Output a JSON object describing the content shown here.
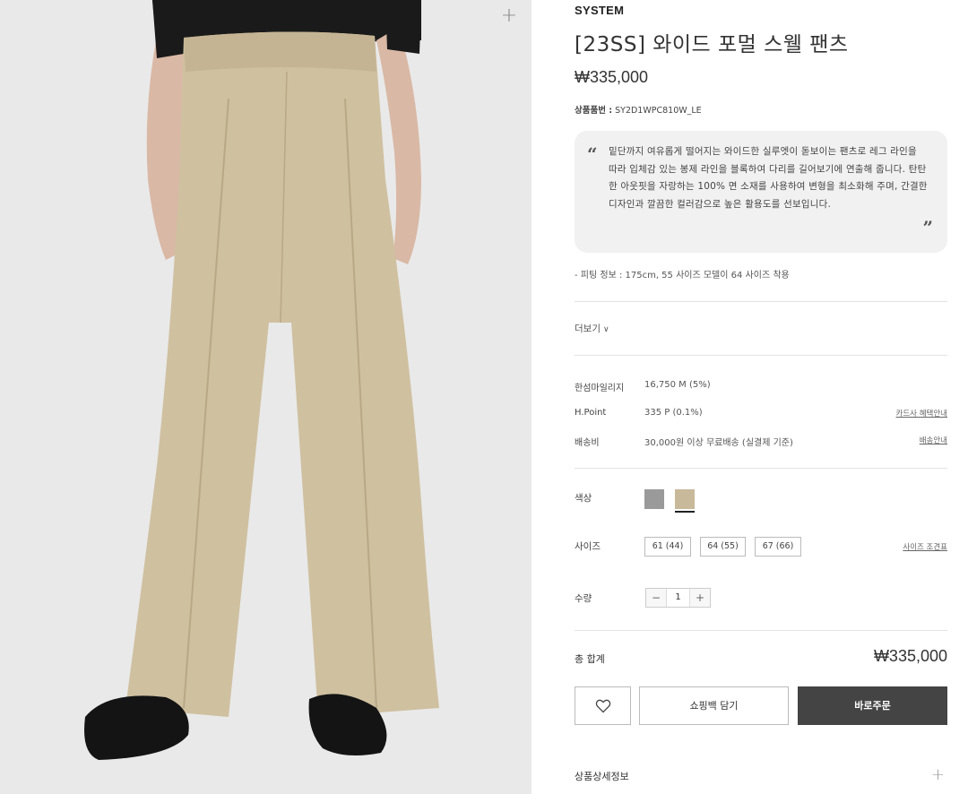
{
  "product": {
    "brand": "SYSTEM",
    "title": "[23SS] 와이드 포멀 스웰 팬츠",
    "price": "₩335,000",
    "code_label": "상품품번 :",
    "code_value": "SY2D1WPC810W_LE",
    "description": "밑단까지 여유롭게 떨어지는 와이드한 실루엣이 돋보이는 팬츠로 레그 라인을 따라 입체감 있는 봉제 라인을 블록하여 다리를 길어보기에 연출해 줍니다. 탄탄한 아웃핏을 자랑하는 100% 면 소재를 사용하여 변형을 최소화해 주며, 간결한 디자인과 깔끔한 컬러감으로 높은 활용도를 선보입니다.",
    "quote_open": "“",
    "quote_close": "”",
    "fit_info": "- 피팅 정보 : 175cm, 55 사이즈 모델이 64 사이즈 착용",
    "more_label": "더보기",
    "more_chevron": "∨"
  },
  "benefits": [
    {
      "key": "한섬마일리지",
      "value": "16,750 M (5%)",
      "link": ""
    },
    {
      "key": "H.Point",
      "value": "335 P (0.1%)",
      "link": "카드사 혜택안내"
    },
    {
      "key": "배송비",
      "value": "30,000원 이상 무료배송 (실결제 기준)",
      "link": "배송안내"
    }
  ],
  "options": {
    "color_label": "색상",
    "colors": [
      {
        "name": "gray",
        "hex": "#9a9a9a"
      },
      {
        "name": "beige",
        "hex": "#c8b99a",
        "selected": true
      }
    ],
    "size_label": "사이즈",
    "sizes": [
      "61 (44)",
      "64 (55)",
      "67 (66)"
    ],
    "size_guide": "사이즈 조견표",
    "qty_label": "수량",
    "qty_minus": "−",
    "qty_value": "1",
    "qty_plus": "+"
  },
  "total": {
    "label": "총 합계",
    "value": "₩335,000"
  },
  "actions": {
    "wish_icon": "heart-icon",
    "cart_label": "쇼핑백 담기",
    "buy_label": "바로주문"
  },
  "detail": {
    "label": "상품상세정보",
    "toggle": "+"
  },
  "image": {
    "zoom": "+",
    "background": "#e9e9e9",
    "pants_color": "#cfc0a0"
  }
}
